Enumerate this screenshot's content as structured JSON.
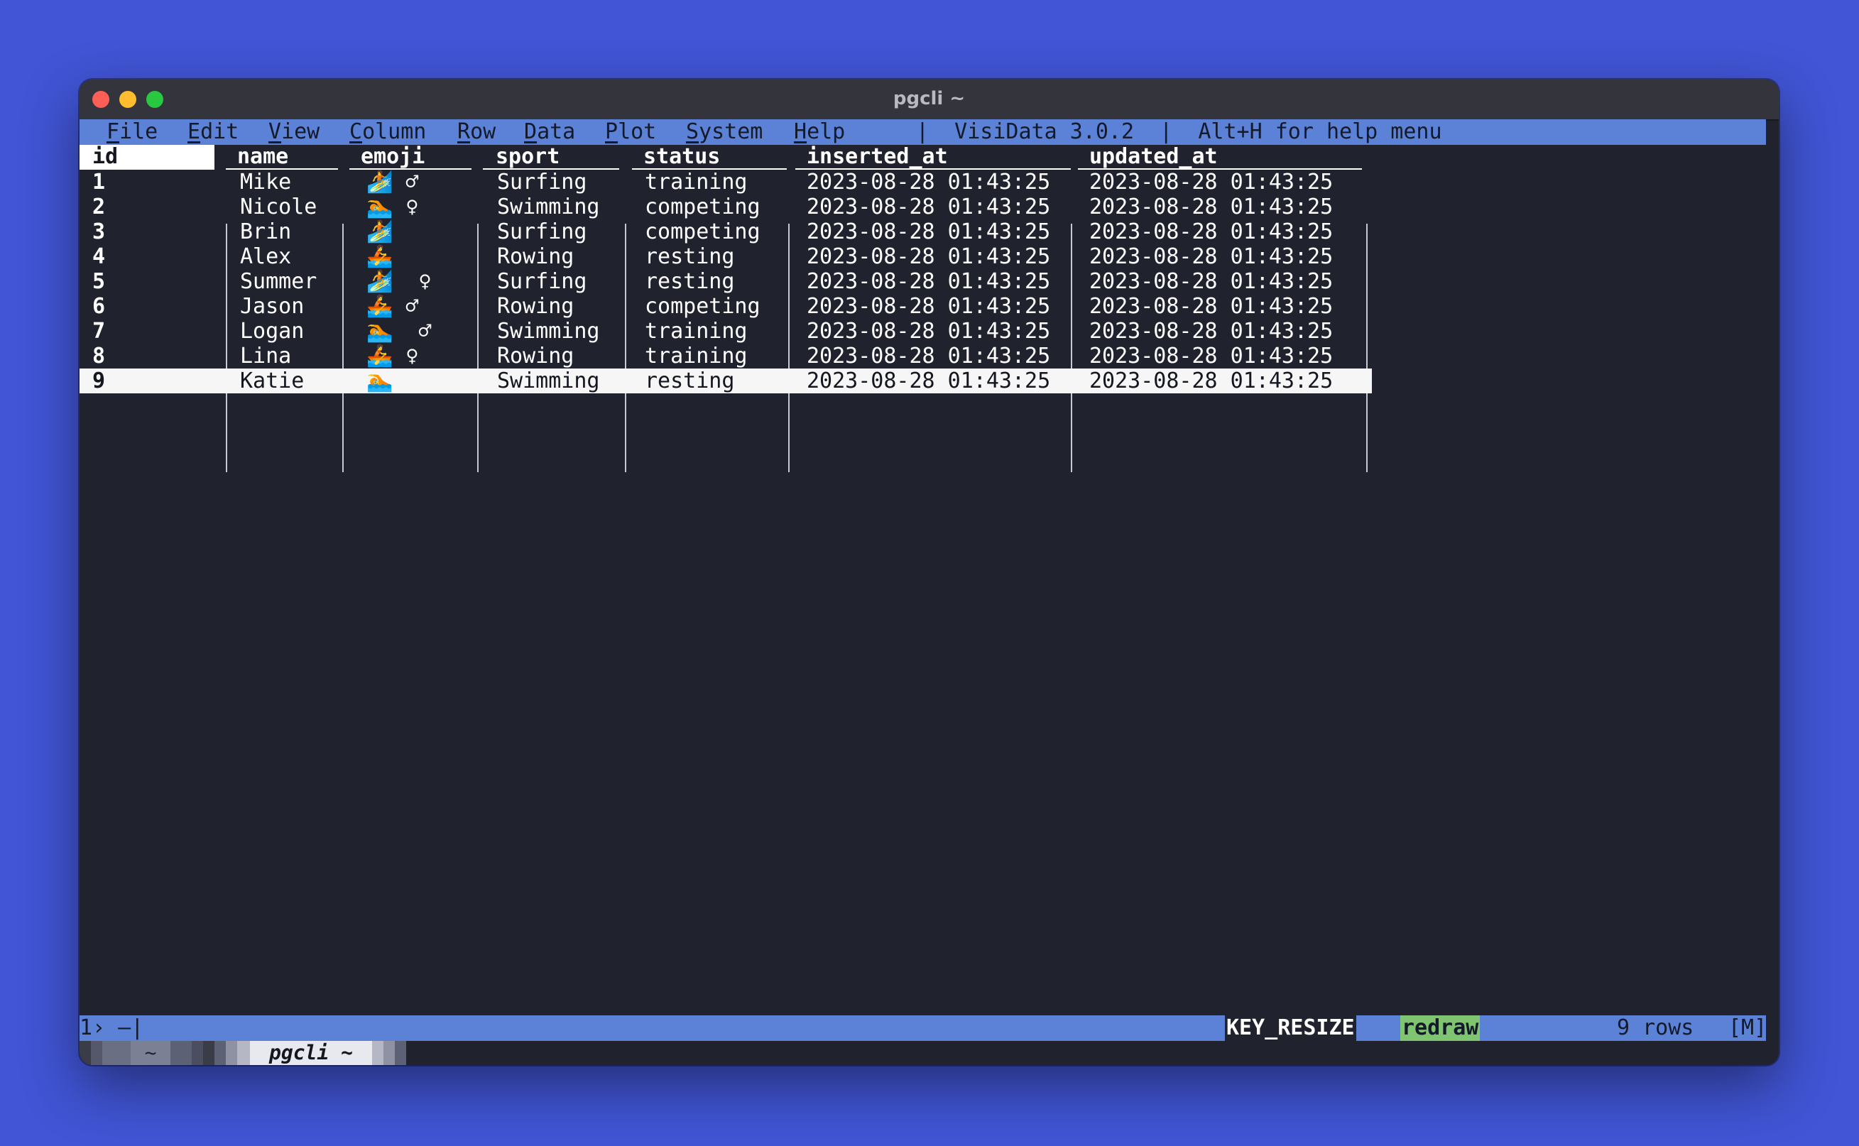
{
  "window": {
    "title": "pgcli ~"
  },
  "menu": {
    "items": [
      "File",
      "Edit",
      "View",
      "Column",
      "Row",
      "Data",
      "Plot",
      "System",
      "Help"
    ],
    "info": "|  VisiData 3.0.2  |  Alt+H for help menu"
  },
  "table": {
    "columns": [
      "id",
      "name",
      "emoji",
      "sport",
      "status",
      "inserted_at",
      "updated_at"
    ],
    "rows": [
      [
        "1",
        "Mike",
        "🏄 ♂",
        "Surfing",
        "training",
        "2023-08-28 01:43:25",
        "2023-08-28 01:43:25"
      ],
      [
        "2",
        "Nicole",
        "🏊 ♀",
        "Swimming",
        "competing",
        "2023-08-28 01:43:25",
        "2023-08-28 01:43:25"
      ],
      [
        "3",
        "Brin",
        "🏄",
        "Surfing",
        "competing",
        "2023-08-28 01:43:25",
        "2023-08-28 01:43:25"
      ],
      [
        "4",
        "Alex",
        "🚣",
        "Rowing",
        "resting",
        "2023-08-28 01:43:25",
        "2023-08-28 01:43:25"
      ],
      [
        "5",
        "Summer",
        "🏄  ♀",
        "Surfing",
        "resting",
        "2023-08-28 01:43:25",
        "2023-08-28 01:43:25"
      ],
      [
        "6",
        "Jason",
        "🚣 ♂",
        "Rowing",
        "competing",
        "2023-08-28 01:43:25",
        "2023-08-28 01:43:25"
      ],
      [
        "7",
        "Logan",
        "🏊  ♂",
        "Swimming",
        "training",
        "2023-08-28 01:43:25",
        "2023-08-28 01:43:25"
      ],
      [
        "8",
        "Lina",
        "🚣 ♀",
        "Rowing",
        "training",
        "2023-08-28 01:43:25",
        "2023-08-28 01:43:25"
      ],
      [
        "9",
        "Katie",
        "🏊",
        "Swimming",
        "resting",
        "2023-08-28 01:43:25",
        "2023-08-28 01:43:25"
      ]
    ],
    "selected_row": 9
  },
  "status": {
    "sheet": "1› –|",
    "key": "KEY_RESIZE",
    "command": "redraw",
    "rows": "9 rows",
    "mode": "[M]"
  },
  "tmux": {
    "window1": "~",
    "window2": "pgcli ~"
  }
}
